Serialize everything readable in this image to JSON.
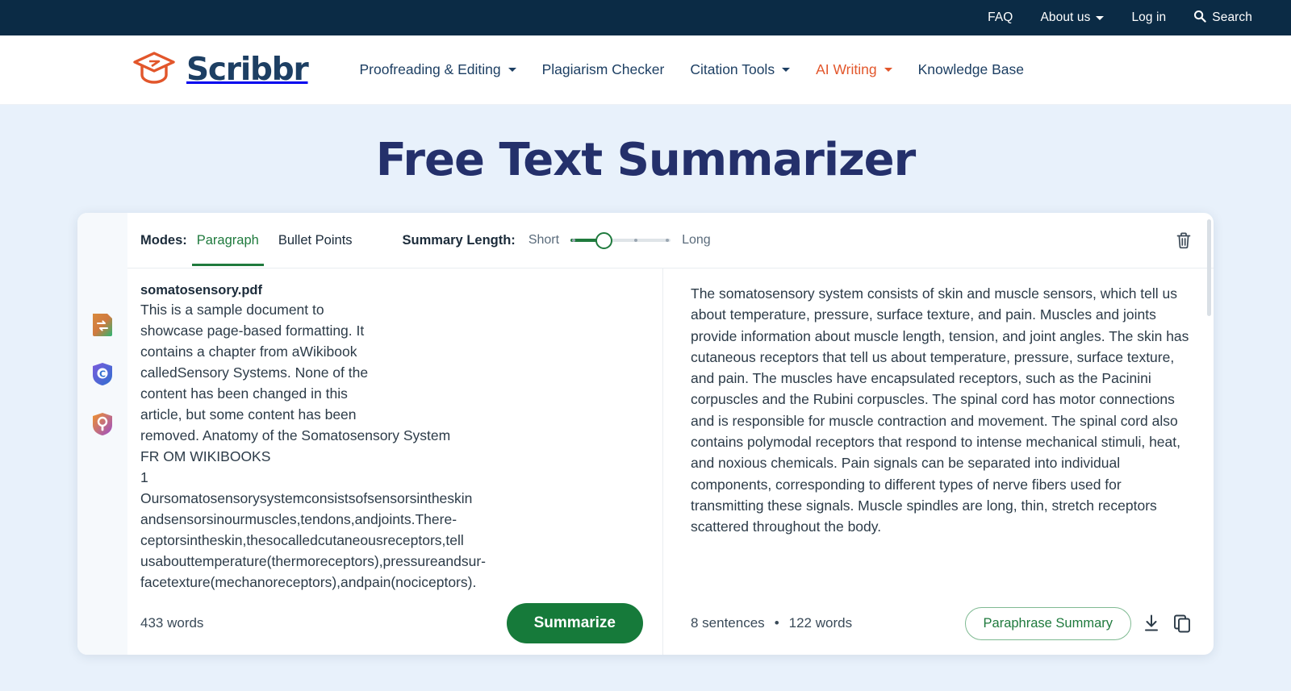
{
  "topbar": {
    "links": [
      {
        "label": "FAQ",
        "icon": null,
        "caret": false
      },
      {
        "label": "About us",
        "icon": null,
        "caret": true
      },
      {
        "label": "Log in",
        "icon": null,
        "caret": false
      },
      {
        "label": "Search",
        "icon": "search-icon",
        "caret": false
      }
    ]
  },
  "brand": {
    "name": "Scribbr",
    "logo_icon": "graduation-cap-icon",
    "logo_color": "#e2562b",
    "wordmark_color": "#1d3f63"
  },
  "nav": {
    "items": [
      {
        "label": "Proofreading & Editing",
        "caret": true,
        "active": false
      },
      {
        "label": "Plagiarism Checker",
        "caret": false,
        "active": false
      },
      {
        "label": "Citation Tools",
        "caret": true,
        "active": false
      },
      {
        "label": "AI Writing",
        "caret": true,
        "active": true
      },
      {
        "label": "Knowledge Base",
        "caret": false,
        "active": false
      }
    ],
    "active_color": "#e2562b"
  },
  "hero": {
    "title": "Free Text Summarizer"
  },
  "extensions": [
    {
      "name": "paraphraser-extension-icon"
    },
    {
      "name": "shield-c-extension-icon"
    },
    {
      "name": "shield-search-extension-icon"
    }
  ],
  "toolbar": {
    "modes_label": "Modes:",
    "modes": [
      {
        "label": "Paragraph",
        "active": true
      },
      {
        "label": "Bullet Points",
        "active": false
      }
    ],
    "length_label": "Summary Length:",
    "length_min": "Short",
    "length_max": "Long",
    "slider": {
      "positions": 4,
      "value": 2,
      "accent": "#1f7a3d"
    },
    "delete_icon": "trash-icon"
  },
  "input_pane": {
    "source_name": "somatosensory.pdf",
    "text": "This is a sample document to\nshowcase page-based formatting. It\ncontains a chapter from aWikibook\ncalledSensory Systems. None of the\ncontent has been changed in this\narticle, but some content has been\nremoved. Anatomy of the Somatosensory System\nFR OM WIKIBOOKS\n1\nOursomatosensorysystemconsistsofsensorsintheskin\nandsensorsinourmuscles,tendons,andjoints.There-\nceptorsintheskin,thesocalledcutaneousreceptors,tell\nusabouttemperature(thermoreceptors),pressureandsur-\nfacetexture(mechanoreceptors),andpain(nociceptors).\nThereceptorsinmusclesandjointsprovideinformation",
    "word_count": "433 words",
    "summarize_label": "Summarize"
  },
  "output_pane": {
    "summary": "The somatosensory system consists of skin and muscle sensors, which tell us about temperature, pressure, surface texture, and pain. Muscles and joints provide information about muscle length, tension, and joint angles. The skin has cutaneous receptors that tell us about temperature, pressure, surface texture, and pain. The muscles have encapsulated receptors, such as the Pacinini corpuscles and the Rubini corpuscles. The spinal cord has motor connections and is responsible for muscle contraction and movement. The spinal cord also contains polymodal receptors that respond to intense mechanical stimuli, heat, and noxious chemicals. Pain signals can be separated into individual components, corresponding to different types of nerve fibers used for transmitting these signals. Muscle spindles are long, thin, stretch receptors scattered throughout the body.",
    "sentence_count": "8 sentences",
    "separator": "•",
    "word_count": "122 words",
    "paraphrase_label": "Paraphrase Summary",
    "download_icon": "download-icon",
    "copy_icon": "copy-icon"
  }
}
